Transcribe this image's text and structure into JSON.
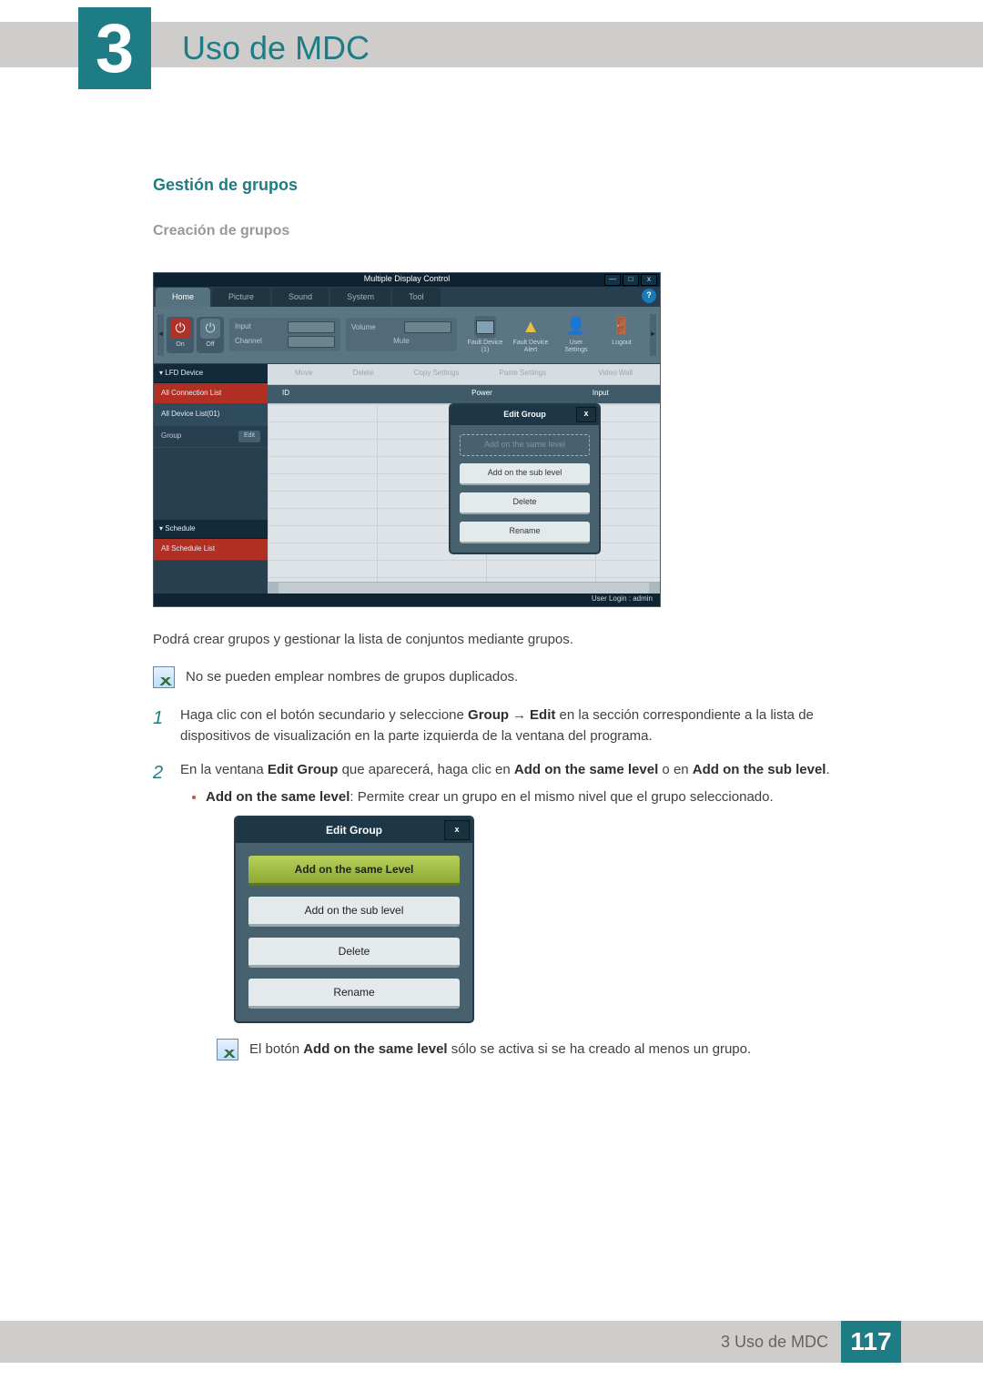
{
  "chapter": {
    "number": "3",
    "title": "Uso de MDC"
  },
  "section": {
    "title": "Gestión de grupos",
    "subtitle": "Creación de grupos"
  },
  "para_intro": "Podrá crear grupos y gestionar la lista de conjuntos mediante grupos.",
  "note1": "No se pueden emplear nombres de grupos duplicados.",
  "steps": {
    "s1_num": "1",
    "s1_a": "Haga clic con el botón secundario y seleccione ",
    "s1_b1": "Group",
    "s1_b2": "Edit",
    "s1_c": " en la sección correspondiente a la lista de dispositivos de visualización en la parte izquierda de la ventana del programa.",
    "s2_num": "2",
    "s2_a": "En la ventana ",
    "s2_b1": "Edit Group",
    "s2_c": " que aparecerá, haga clic en ",
    "s2_b2": "Add on the same level",
    "s2_d": " o en ",
    "s2_b3": "Add on the sub level",
    "s2_e": ".",
    "bul_b": "Add on the same level",
    "bul_t": ": Permite crear un grupo en el mismo nivel que el grupo seleccionado."
  },
  "note2_a": "El botón ",
  "note2_b": "Add on the same level",
  "note2_c": " sólo se activa si se ha creado al menos un grupo.",
  "app": {
    "title": "Multiple Display Control",
    "tabs": {
      "home": "Home",
      "picture": "Picture",
      "sound": "Sound",
      "system": "System",
      "tool": "Tool"
    },
    "help": "?",
    "power": {
      "on": "On",
      "off": "Off"
    },
    "panel1": {
      "input": "Input",
      "channel": "Channel"
    },
    "panel2": {
      "volume": "Volume",
      "mute": "Mute"
    },
    "icons": {
      "fd1": "Fault Device (1)",
      "fda": "Fault Device Alert",
      "us": "User Settings",
      "logout": "Logout"
    },
    "side": {
      "lfd": "LFD Device",
      "acl": "All Connection List",
      "adl": "All Device List(01)",
      "group": "Group",
      "edit": "Edit",
      "schedule": "Schedule",
      "asl": "All Schedule List"
    },
    "btns": {
      "move": "Move",
      "delete": "Delete",
      "copy": "Copy Settings",
      "paste": "Paste Settings",
      "vw": "Video Wall"
    },
    "cols": {
      "id": "ID",
      "power": "Power",
      "input": "Input"
    },
    "footer": "User Login : admin"
  },
  "popup": {
    "title": "Edit Group",
    "o1": "Add on the same level",
    "o1b": "Add on the same Level",
    "o2": "Add on the sub level",
    "o3": "Delete",
    "o4": "Rename",
    "x": "x"
  },
  "pf": {
    "text": "3 Uso de MDC",
    "num": "117"
  }
}
